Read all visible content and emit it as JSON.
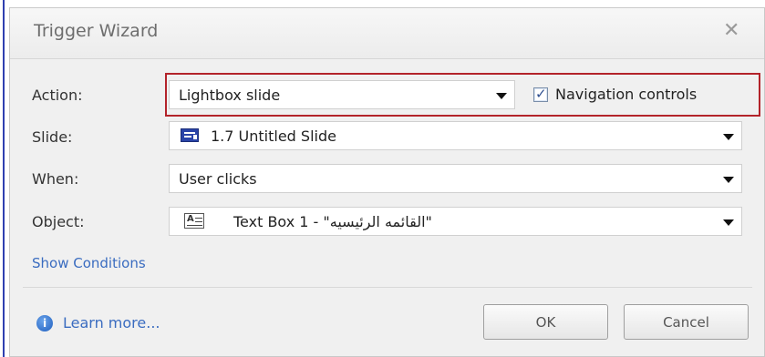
{
  "dialog": {
    "title": "Trigger Wizard",
    "close_icon": "close-icon"
  },
  "rows": {
    "action": {
      "label": "Action:",
      "value": "Lightbox slide",
      "option_label": "Navigation controls",
      "option_checked": true
    },
    "slide": {
      "label": "Slide:",
      "value": "1.7 Untitled Slide",
      "icon": "slide-icon"
    },
    "when": {
      "label": "When:",
      "value": "User clicks"
    },
    "object": {
      "label": "Object:",
      "value": "Text Box 1 - \"القائمه الرئيسيه\"",
      "icon": "text-box-icon"
    }
  },
  "links": {
    "show_conditions": "Show Conditions",
    "learn_more": "Learn more..."
  },
  "buttons": {
    "ok": "OK",
    "cancel": "Cancel"
  },
  "colors": {
    "highlight_border": "#b3232a",
    "link": "#3a6cc0"
  }
}
